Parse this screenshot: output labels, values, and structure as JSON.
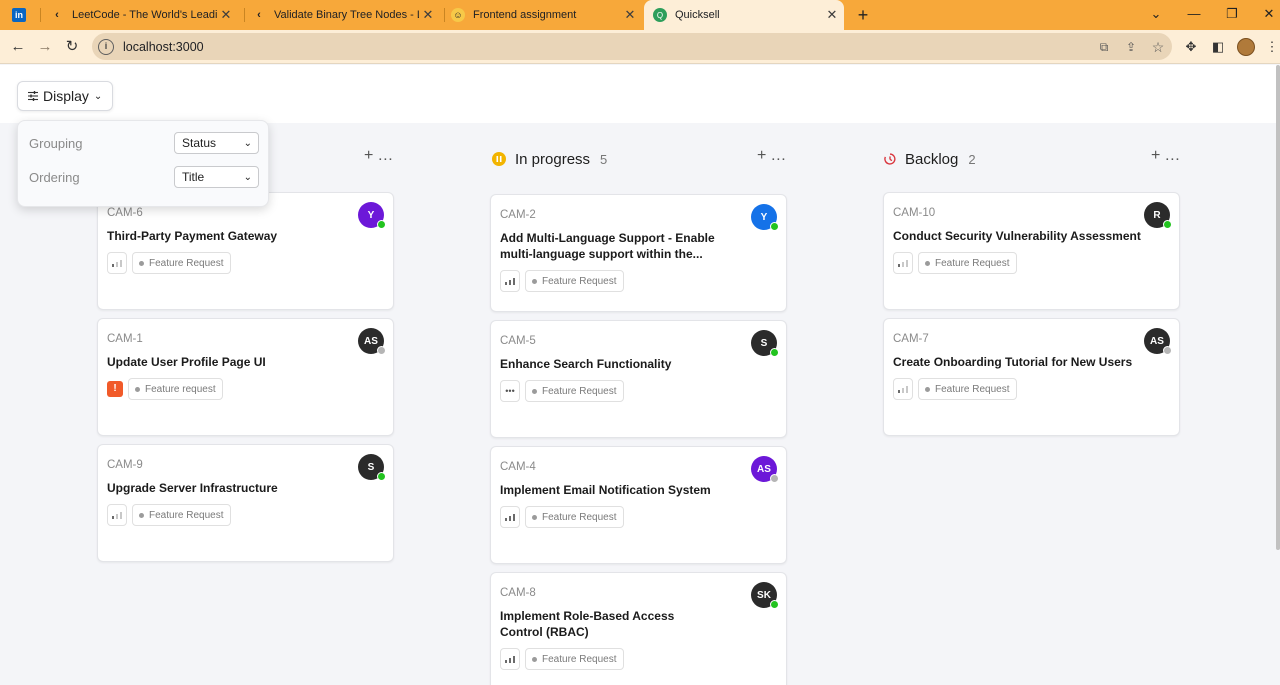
{
  "browser": {
    "tabs": [
      {
        "title": "LeetCode - The World's Leading",
        "icon": "leetcode-icon"
      },
      {
        "title": "Validate Binary Tree Nodes - Lee",
        "icon": "leetcode-icon"
      },
      {
        "title": "Frontend assignment",
        "icon": "smiley-icon"
      },
      {
        "title": "Quicksell",
        "icon": "quicksell-icon"
      }
    ],
    "url": "localhost:3000",
    "colors": {
      "tabstrip": "#f7a83a",
      "toolbar": "#fdeed7"
    }
  },
  "toolbar": {
    "display_label": "Display"
  },
  "display_menu": {
    "grouping_label": "Grouping",
    "grouping_value": "Status",
    "ordering_label": "Ordering",
    "ordering_value": "Title"
  },
  "board": {
    "columns": [
      {
        "title": "",
        "count": "",
        "cards": [
          {
            "id": "CAM-6",
            "title": "Third-Party Payment Gateway",
            "priority": "low",
            "tag": "Feature Request",
            "avatar": "Y",
            "avatar_color": "#6c18d8",
            "online": true
          },
          {
            "id": "CAM-1",
            "title": "Update User Profile Page UI",
            "priority": "urgent",
            "priority_text": "!",
            "tag": "Feature request",
            "avatar": "AS",
            "avatar_color": "#2b2b2b",
            "online": false
          },
          {
            "id": "CAM-9",
            "title": "Upgrade Server Infrastructure",
            "priority": "low",
            "tag": "Feature Request",
            "avatar": "S",
            "avatar_color": "#2b2b2b",
            "online": true
          }
        ]
      },
      {
        "title": "In progress",
        "count": "5",
        "status_color": "#f2b400",
        "cards": [
          {
            "id": "CAM-2",
            "title": "Add Multi-Language Support - Enable multi-language support within the...",
            "priority": "high",
            "tag": "Feature Request",
            "avatar": "Y",
            "avatar_color": "#1572e8",
            "online": true
          },
          {
            "id": "CAM-5",
            "title": "Enhance Search Functionality",
            "priority": "none",
            "priority_text": "•••",
            "tag": "Feature Request",
            "avatar": "S",
            "avatar_color": "#2b2b2b",
            "online": true
          },
          {
            "id": "CAM-4",
            "title": "Implement Email Notification System",
            "priority": "high",
            "tag": "Feature Request",
            "avatar": "AS",
            "avatar_color": "#6c18d8",
            "online": false
          },
          {
            "id": "CAM-8",
            "title": "Implement Role-Based Access Control (RBAC)",
            "priority": "high",
            "tag": "Feature Request",
            "avatar": "SK",
            "avatar_color": "#2b2b2b",
            "online": true
          }
        ]
      },
      {
        "title": "Backlog",
        "count": "2",
        "status_color": "#d9363e",
        "cards": [
          {
            "id": "CAM-10",
            "title": "Conduct Security Vulnerability Assessment",
            "priority": "low",
            "tag": "Feature Request",
            "avatar": "R",
            "avatar_color": "#2b2b2b",
            "online": true
          },
          {
            "id": "CAM-7",
            "title": "Create Onboarding Tutorial for New Users",
            "priority": "low",
            "tag": "Feature Request",
            "avatar": "AS",
            "avatar_color": "#2b2b2b",
            "online": false
          }
        ]
      }
    ]
  },
  "status_colors": {
    "online": "#22c31f",
    "offline": "#b5b5b5"
  }
}
